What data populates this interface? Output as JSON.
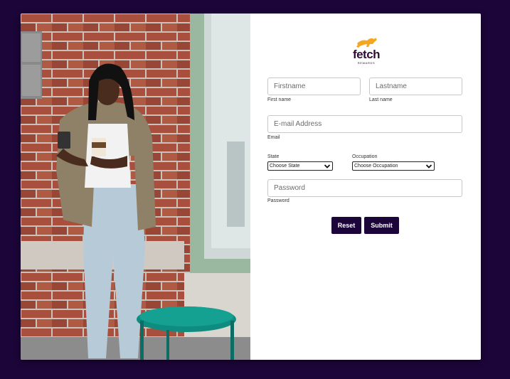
{
  "brand": {
    "name": "fetch",
    "sub": "REWARDS",
    "color": "#300d38",
    "mascot_color": "#f5a623"
  },
  "form": {
    "firstname": {
      "placeholder": "Firstname",
      "label": "First name"
    },
    "lastname": {
      "placeholder": "Lastname",
      "label": "Last name"
    },
    "email": {
      "placeholder": "E-mail Address",
      "label": "Email"
    },
    "state": {
      "label": "State",
      "selected": "Choose State"
    },
    "occupation": {
      "label": "Occupation",
      "selected": "Choose Occupation"
    },
    "password": {
      "placeholder": "Password",
      "label": "Password"
    },
    "reset_label": "Reset",
    "submit_label": "Submit"
  },
  "colors": {
    "background": "#1c0538",
    "button": "#1c0538",
    "card": "#ffffff"
  },
  "icons": {
    "select_chevron": "chevron-down-icon"
  }
}
